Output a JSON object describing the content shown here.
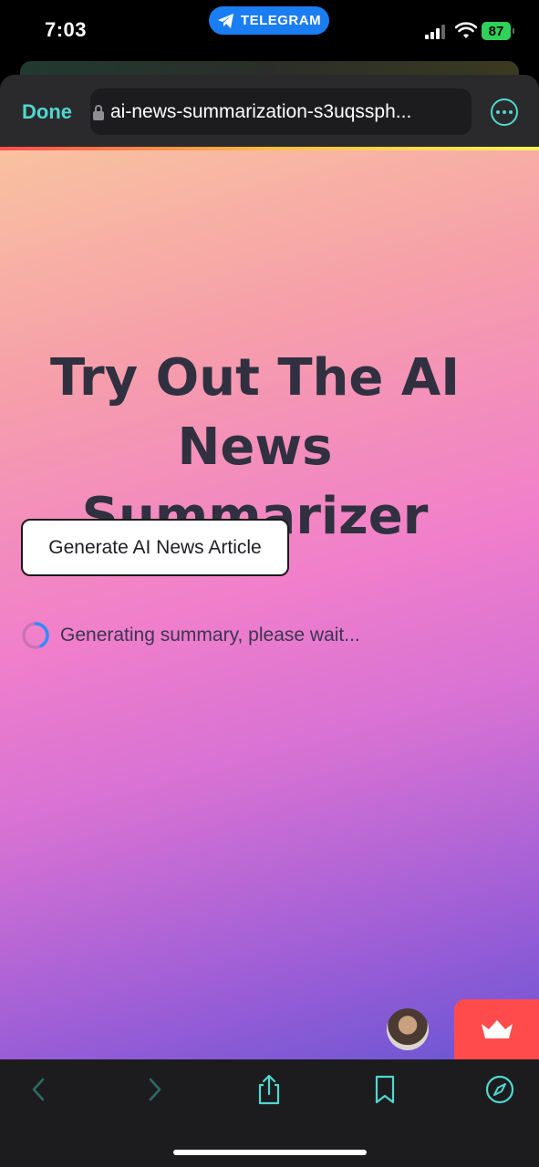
{
  "status_bar": {
    "time": "7:03",
    "app_pill_label": "TELEGRAM",
    "battery": "87",
    "icons": [
      "telegram-icon",
      "signal-icon",
      "wifi-icon",
      "battery-icon"
    ]
  },
  "browser": {
    "done_label": "Done",
    "url": "ai-news-summarization-s3uqssph...",
    "accent_color": "#4fd8cf",
    "icons": [
      "lock-icon",
      "more-icon"
    ]
  },
  "page": {
    "title": "Try Out The AI News Summarizer",
    "generate_button_label": "Generate AI News Article",
    "loading_text": "Generating summary, please wait...",
    "widget_icons": [
      "avatar",
      "crown-icon"
    ],
    "gradient_colors": [
      "#f9c2a0",
      "#f17fcb",
      "#6a55d4"
    ]
  },
  "toolbar": {
    "icons": [
      "back-icon",
      "forward-icon",
      "share-icon",
      "bookmarks-icon",
      "compass-icon"
    ]
  }
}
